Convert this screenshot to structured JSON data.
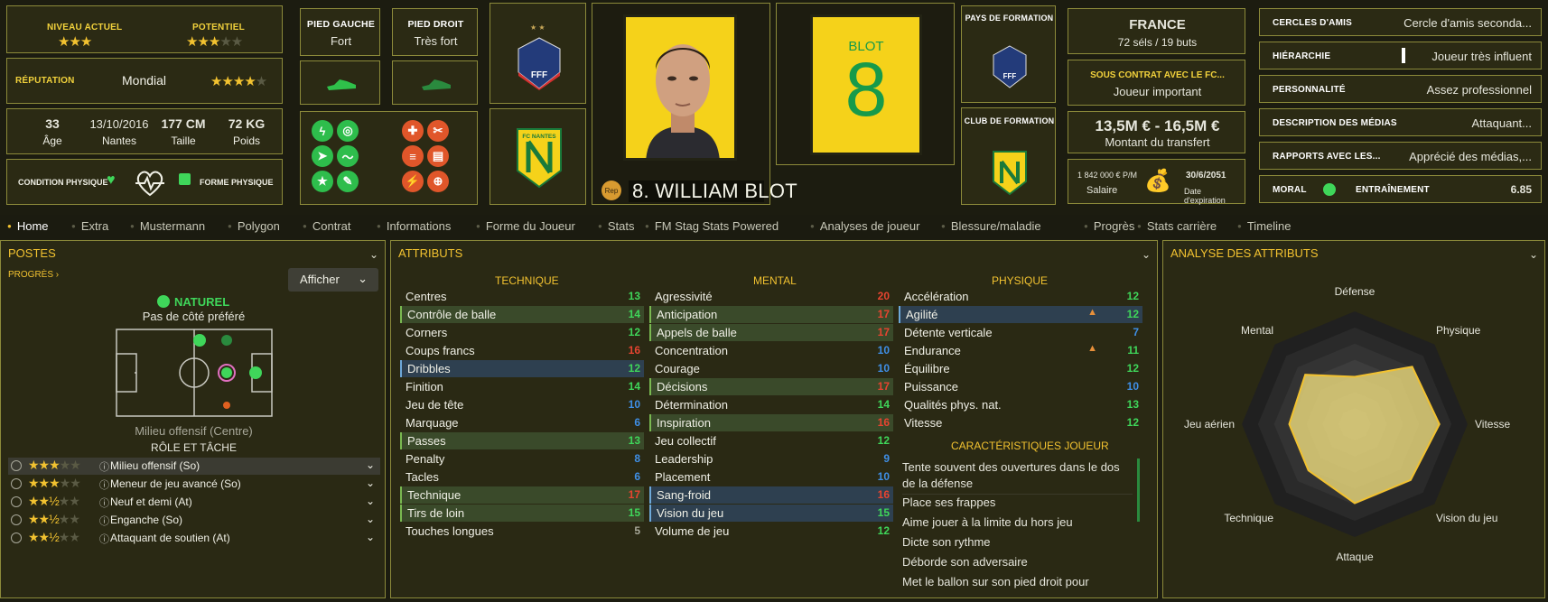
{
  "header": {
    "niveau_actuel_label": "NIVEAU ACTUEL",
    "potentiel_label": "POTENTIEL",
    "niveau_actuel_stars": "★★★",
    "niveau_actuel_stars_off": "",
    "potentiel_stars": "★★★",
    "potentiel_stars_off": "★★",
    "reputation_label": "RÉPUTATION",
    "reputation_value": "Mondial",
    "reputation_stars": "★★★★",
    "reputation_stars_off": "★",
    "age_value": "33",
    "age_label": "Âge",
    "birth_value": "13/10/2016",
    "birth_label": "Nantes",
    "height_value": "177 CM",
    "height_label": "Taille",
    "weight_value": "72 KG",
    "weight_label": "Poids",
    "condition_label": "CONDITION PHYSIQUE",
    "forme_label": "FORME PHYSIQUE",
    "pied_gauche_label": "PIED GAUCHE",
    "pied_gauche_value": "Fort",
    "pied_droit_label": "PIED DROIT",
    "pied_droit_value": "Très fort",
    "fff_text": "FFF",
    "fcn_text": "FC NANTES",
    "shirt_name": "BLOT",
    "shirt_number": "8",
    "rep_badge": "Rep",
    "player_name": "8. WILLIAM BLOT",
    "pays_formation_label": "PAYS DE FORMATION",
    "club_formation_label": "CLUB DE FORMATION",
    "nation": "FRANCE",
    "nation_caps": "72 séls / 19 buts",
    "contract_label": "SOUS CONTRAT AVEC LE FC...",
    "contract_value": "Joueur important",
    "transfer_value": "13,5M € - 16,5M €",
    "transfer_label": "Montant du transfert",
    "salary_value": "1 842 000 € P/M",
    "salary_label": "Salaire",
    "expiry_value": "30/6/2051",
    "expiry_label": "Date d'expiration",
    "info_rows": [
      {
        "label": "CERCLES D'AMIS",
        "value": "Cercle d'amis seconda..."
      },
      {
        "label": "HIÉRARCHIE",
        "value": "Joueur très influent"
      },
      {
        "label": "PERSONNALITÉ",
        "value": "Assez professionnel"
      },
      {
        "label": "DESCRIPTION DES MÉDIAS",
        "value": "Attaquant..."
      },
      {
        "label": "RAPPORTS AVEC LES...",
        "value": "Apprécié des médias,..."
      }
    ],
    "moral_label": "MORAL",
    "training_label": "ENTRAÎNEMENT",
    "training_value": "6.85"
  },
  "tabs": [
    "Home",
    "Extra",
    "Mustermann",
    "Polygon",
    "Contrat",
    "Informations",
    "Forme du Joueur",
    "Stats",
    "FM Stag Stats Powered",
    "Analyses de joueur",
    "Blessure/maladie",
    "Progrès",
    "Stats carrière",
    "Timeline"
  ],
  "postes": {
    "title": "POSTES",
    "progres": "PROGRÈS",
    "afficher": "Afficher",
    "naturel": "NATUREL",
    "cote": "Pas de côté préféré",
    "position": "Milieu offensif (Centre)",
    "role_title": "RÔLE ET TÂCHE",
    "roles": [
      {
        "stars": "★★★",
        "off": "★★",
        "name": "Milieu offensif (So)"
      },
      {
        "stars": "★★★",
        "off": "★★",
        "name": "Meneur de jeu avancé (So)"
      },
      {
        "stars": "★★½",
        "off": "★★",
        "name": "Neuf et demi (At)"
      },
      {
        "stars": "★★½",
        "off": "★★",
        "name": "Enganche (So)"
      },
      {
        "stars": "★★½",
        "off": "★★",
        "name": "Attaquant de soutien (At)"
      }
    ]
  },
  "attributs": {
    "title": "ATTRIBUTS",
    "technique_title": "TECHNIQUE",
    "mental_title": "MENTAL",
    "physique_title": "PHYSIQUE",
    "technique": [
      {
        "name": "Centres",
        "value": "13"
      },
      {
        "name": "Contrôle de balle",
        "value": "14"
      },
      {
        "name": "Corners",
        "value": "12"
      },
      {
        "name": "Coups francs",
        "value": "16"
      },
      {
        "name": "Dribbles",
        "value": "12"
      },
      {
        "name": "Finition",
        "value": "14"
      },
      {
        "name": "Jeu de tête",
        "value": "10"
      },
      {
        "name": "Marquage",
        "value": "6"
      },
      {
        "name": "Passes",
        "value": "13"
      },
      {
        "name": "Penalty",
        "value": "8"
      },
      {
        "name": "Tacles",
        "value": "6"
      },
      {
        "name": "Technique",
        "value": "17"
      },
      {
        "name": "Tirs de loin",
        "value": "15"
      },
      {
        "name": "Touches longues",
        "value": "5"
      }
    ],
    "mental": [
      {
        "name": "Agressivité",
        "value": "20"
      },
      {
        "name": "Anticipation",
        "value": "17"
      },
      {
        "name": "Appels de balle",
        "value": "17"
      },
      {
        "name": "Concentration",
        "value": "10"
      },
      {
        "name": "Courage",
        "value": "10"
      },
      {
        "name": "Décisions",
        "value": "17"
      },
      {
        "name": "Détermination",
        "value": "14"
      },
      {
        "name": "Inspiration",
        "value": "16"
      },
      {
        "name": "Jeu collectif",
        "value": "12"
      },
      {
        "name": "Leadership",
        "value": "9"
      },
      {
        "name": "Placement",
        "value": "10"
      },
      {
        "name": "Sang-froid",
        "value": "16"
      },
      {
        "name": "Vision du jeu",
        "value": "15"
      },
      {
        "name": "Volume de jeu",
        "value": "12"
      }
    ],
    "physique": [
      {
        "name": "Accélération",
        "value": "12"
      },
      {
        "name": "Agilité",
        "value": "12"
      },
      {
        "name": "Détente verticale",
        "value": "7"
      },
      {
        "name": "Endurance",
        "value": "11"
      },
      {
        "name": "Équilibre",
        "value": "12"
      },
      {
        "name": "Puissance",
        "value": "10"
      },
      {
        "name": "Qualités phys. nat.",
        "value": "13"
      },
      {
        "name": "Vitesse",
        "value": "12"
      }
    ],
    "carac_title": "CARACTÉRISTIQUES JOUEUR",
    "carac_1a": "Tente souvent des ouvertures dans le dos",
    "carac_1b": "de la défense",
    "carac_2": "Place ses frappes",
    "carac_3": "Aime jouer à la limite du hors jeu",
    "carac_4": "Dicte son rythme",
    "carac_5": "Déborde son adversaire",
    "carac_6": "Met le ballon sur son pied droit pour"
  },
  "analyse": {
    "title": "ANALYSE DES ATTRIBUTS",
    "axes": [
      "Défense",
      "Physique",
      "Vitesse",
      "Vision du jeu",
      "Attaque",
      "Technique",
      "Jeu aérien",
      "Mental"
    ],
    "values": [
      0.42,
      0.72,
      0.75,
      0.7,
      0.7,
      0.58,
      0.58,
      0.62
    ]
  },
  "colors": {
    "accent": "#f2c230",
    "border": "#8c8a3a",
    "green": "#3fd65a",
    "red": "#e64430",
    "blue": "#3f8fe6"
  }
}
